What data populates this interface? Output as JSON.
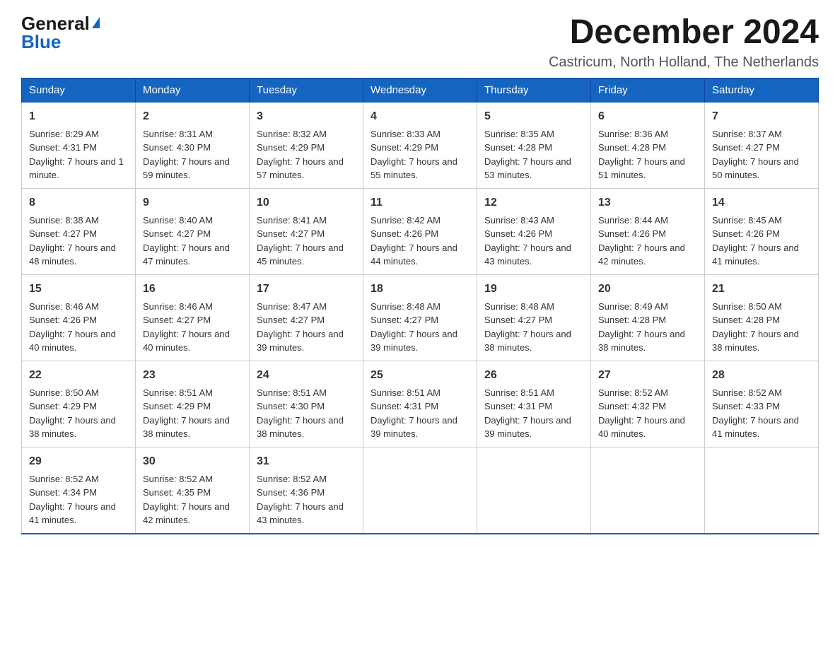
{
  "header": {
    "logo_general": "General",
    "logo_blue": "Blue",
    "month_title": "December 2024",
    "location": "Castricum, North Holland, The Netherlands"
  },
  "columns": [
    "Sunday",
    "Monday",
    "Tuesday",
    "Wednesday",
    "Thursday",
    "Friday",
    "Saturday"
  ],
  "weeks": [
    [
      {
        "day": "1",
        "sunrise": "8:29 AM",
        "sunset": "4:31 PM",
        "daylight": "7 hours and 1 minute."
      },
      {
        "day": "2",
        "sunrise": "8:31 AM",
        "sunset": "4:30 PM",
        "daylight": "7 hours and 59 minutes."
      },
      {
        "day": "3",
        "sunrise": "8:32 AM",
        "sunset": "4:29 PM",
        "daylight": "7 hours and 57 minutes."
      },
      {
        "day": "4",
        "sunrise": "8:33 AM",
        "sunset": "4:29 PM",
        "daylight": "7 hours and 55 minutes."
      },
      {
        "day": "5",
        "sunrise": "8:35 AM",
        "sunset": "4:28 PM",
        "daylight": "7 hours and 53 minutes."
      },
      {
        "day": "6",
        "sunrise": "8:36 AM",
        "sunset": "4:28 PM",
        "daylight": "7 hours and 51 minutes."
      },
      {
        "day": "7",
        "sunrise": "8:37 AM",
        "sunset": "4:27 PM",
        "daylight": "7 hours and 50 minutes."
      }
    ],
    [
      {
        "day": "8",
        "sunrise": "8:38 AM",
        "sunset": "4:27 PM",
        "daylight": "7 hours and 48 minutes."
      },
      {
        "day": "9",
        "sunrise": "8:40 AM",
        "sunset": "4:27 PM",
        "daylight": "7 hours and 47 minutes."
      },
      {
        "day": "10",
        "sunrise": "8:41 AM",
        "sunset": "4:27 PM",
        "daylight": "7 hours and 45 minutes."
      },
      {
        "day": "11",
        "sunrise": "8:42 AM",
        "sunset": "4:26 PM",
        "daylight": "7 hours and 44 minutes."
      },
      {
        "day": "12",
        "sunrise": "8:43 AM",
        "sunset": "4:26 PM",
        "daylight": "7 hours and 43 minutes."
      },
      {
        "day": "13",
        "sunrise": "8:44 AM",
        "sunset": "4:26 PM",
        "daylight": "7 hours and 42 minutes."
      },
      {
        "day": "14",
        "sunrise": "8:45 AM",
        "sunset": "4:26 PM",
        "daylight": "7 hours and 41 minutes."
      }
    ],
    [
      {
        "day": "15",
        "sunrise": "8:46 AM",
        "sunset": "4:26 PM",
        "daylight": "7 hours and 40 minutes."
      },
      {
        "day": "16",
        "sunrise": "8:46 AM",
        "sunset": "4:27 PM",
        "daylight": "7 hours and 40 minutes."
      },
      {
        "day": "17",
        "sunrise": "8:47 AM",
        "sunset": "4:27 PM",
        "daylight": "7 hours and 39 minutes."
      },
      {
        "day": "18",
        "sunrise": "8:48 AM",
        "sunset": "4:27 PM",
        "daylight": "7 hours and 39 minutes."
      },
      {
        "day": "19",
        "sunrise": "8:48 AM",
        "sunset": "4:27 PM",
        "daylight": "7 hours and 38 minutes."
      },
      {
        "day": "20",
        "sunrise": "8:49 AM",
        "sunset": "4:28 PM",
        "daylight": "7 hours and 38 minutes."
      },
      {
        "day": "21",
        "sunrise": "8:50 AM",
        "sunset": "4:28 PM",
        "daylight": "7 hours and 38 minutes."
      }
    ],
    [
      {
        "day": "22",
        "sunrise": "8:50 AM",
        "sunset": "4:29 PM",
        "daylight": "7 hours and 38 minutes."
      },
      {
        "day": "23",
        "sunrise": "8:51 AM",
        "sunset": "4:29 PM",
        "daylight": "7 hours and 38 minutes."
      },
      {
        "day": "24",
        "sunrise": "8:51 AM",
        "sunset": "4:30 PM",
        "daylight": "7 hours and 38 minutes."
      },
      {
        "day": "25",
        "sunrise": "8:51 AM",
        "sunset": "4:31 PM",
        "daylight": "7 hours and 39 minutes."
      },
      {
        "day": "26",
        "sunrise": "8:51 AM",
        "sunset": "4:31 PM",
        "daylight": "7 hours and 39 minutes."
      },
      {
        "day": "27",
        "sunrise": "8:52 AM",
        "sunset": "4:32 PM",
        "daylight": "7 hours and 40 minutes."
      },
      {
        "day": "28",
        "sunrise": "8:52 AM",
        "sunset": "4:33 PM",
        "daylight": "7 hours and 41 minutes."
      }
    ],
    [
      {
        "day": "29",
        "sunrise": "8:52 AM",
        "sunset": "4:34 PM",
        "daylight": "7 hours and 41 minutes."
      },
      {
        "day": "30",
        "sunrise": "8:52 AM",
        "sunset": "4:35 PM",
        "daylight": "7 hours and 42 minutes."
      },
      {
        "day": "31",
        "sunrise": "8:52 AM",
        "sunset": "4:36 PM",
        "daylight": "7 hours and 43 minutes."
      },
      null,
      null,
      null,
      null
    ]
  ]
}
